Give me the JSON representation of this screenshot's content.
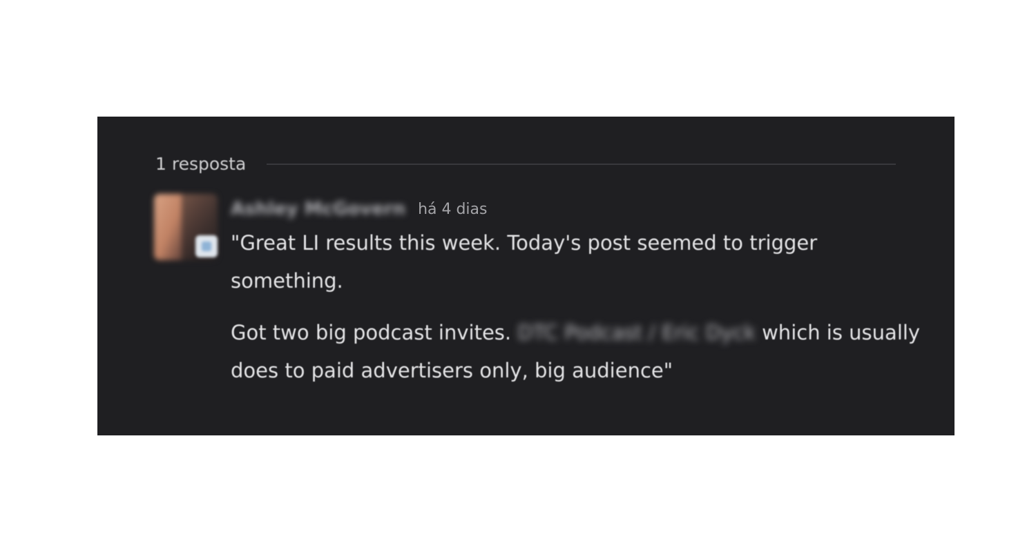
{
  "thread": {
    "reply_count_label": "1 resposta"
  },
  "reply": {
    "author": "Ashley McGovern",
    "timestamp": "há 4 dias",
    "paragraph1": "\"Great LI results this week. Today's post seemed to trigger something.",
    "paragraph2_before": "Got two big podcast invites. ",
    "paragraph2_redacted": "DTC Podcast / Eric Dyck",
    "paragraph2_after": " which is usually does to paid advertisers only, big audience\""
  },
  "colors": {
    "panel_bg": "#1f1f22",
    "text_primary": "#e4e4e6",
    "text_muted": "#a4a4a8",
    "divider": "#38383c"
  }
}
